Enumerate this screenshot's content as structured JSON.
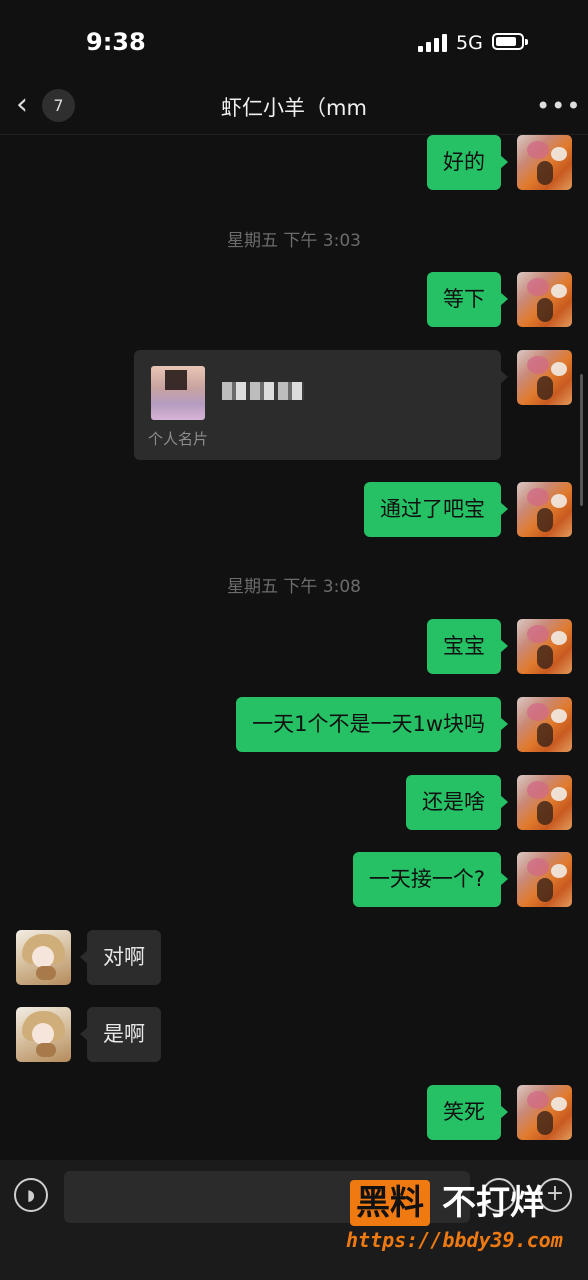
{
  "status_bar": {
    "time": "9:38",
    "network": "5G"
  },
  "nav": {
    "back_glyph": "‹",
    "unread_count": "7",
    "title": "虾仁小羊（mm",
    "more_glyph": "•••"
  },
  "messages": [
    {
      "type": "text",
      "side": "out",
      "text": "好的"
    },
    {
      "type": "timestamp",
      "text": "星期五 下午 3:03"
    },
    {
      "type": "text",
      "side": "out",
      "text": "等下"
    },
    {
      "type": "contact_card",
      "side": "out",
      "label": "个人名片"
    },
    {
      "type": "text",
      "side": "out",
      "text": "通过了吧宝"
    },
    {
      "type": "timestamp",
      "text": "星期五 下午 3:08"
    },
    {
      "type": "text",
      "side": "out",
      "text": "宝宝"
    },
    {
      "type": "text",
      "side": "out",
      "text": "一天1个不是一天1w块吗"
    },
    {
      "type": "text",
      "side": "out",
      "text": "还是啥"
    },
    {
      "type": "text",
      "side": "out",
      "text": "一天接一个?"
    },
    {
      "type": "text",
      "side": "in",
      "text": "对啊"
    },
    {
      "type": "text",
      "side": "in",
      "text": "是啊"
    },
    {
      "type": "text",
      "side": "out",
      "text": "笑死"
    }
  ],
  "input_bar": {
    "placeholder": "",
    "voice_icon": "voice-icon",
    "emoji_icon": "emoji-icon",
    "plus_icon": "plus-icon"
  },
  "watermark": {
    "brand_box": "黑料",
    "brand_rest": "不打烊",
    "url": "https://bbdy39.com"
  },
  "colors": {
    "background": "#111111",
    "outgoing_bubble": "#26c165",
    "incoming_bubble": "#2c2c2c",
    "timestamp": "#6c6c6c",
    "watermark_accent": "#f07a12"
  }
}
